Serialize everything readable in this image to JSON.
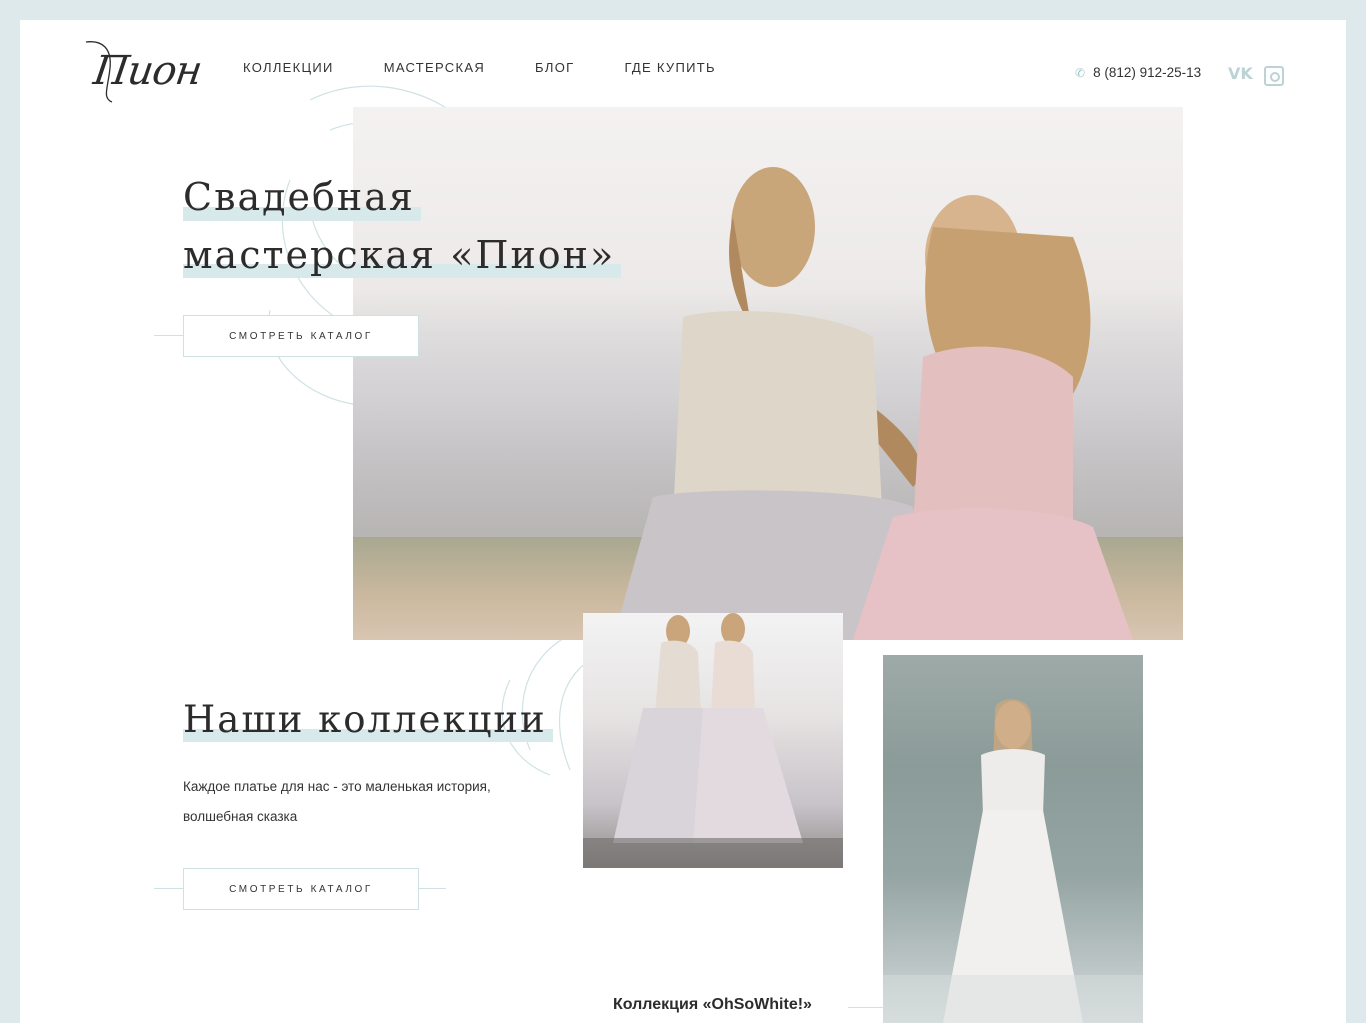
{
  "brand": {
    "logo_text": "Пион"
  },
  "nav": {
    "items": [
      {
        "label": "КОЛЛЕКЦИИ"
      },
      {
        "label": "МАСТЕРСКАЯ"
      },
      {
        "label": "БЛОГ"
      },
      {
        "label": "ГДЕ КУПИТЬ"
      }
    ]
  },
  "contacts": {
    "phone": "8 (812) 912-25-13",
    "phone_icon": "phone-icon"
  },
  "social": {
    "vk_icon": "vk-icon",
    "instagram_icon": "instagram-icon",
    "vk_glyph": "VK"
  },
  "hero": {
    "title_line1": "Свадебная",
    "title_line2": "мастерская «Пион»",
    "button_label": "СМОТРЕТЬ КАТАЛОГ"
  },
  "collections": {
    "title": "Наши коллекции",
    "text_line1": "Каждое платье для нас - это маленькая история,",
    "text_line2": "волшебная сказка",
    "button_label": "СМОТРЕТЬ КАТАЛОГ",
    "caption": "Коллекция «OhSoWhite!»"
  },
  "colors": {
    "accent": "#d7e9ea",
    "frame": "#dde9ea",
    "icon": "#bcd3d5"
  }
}
